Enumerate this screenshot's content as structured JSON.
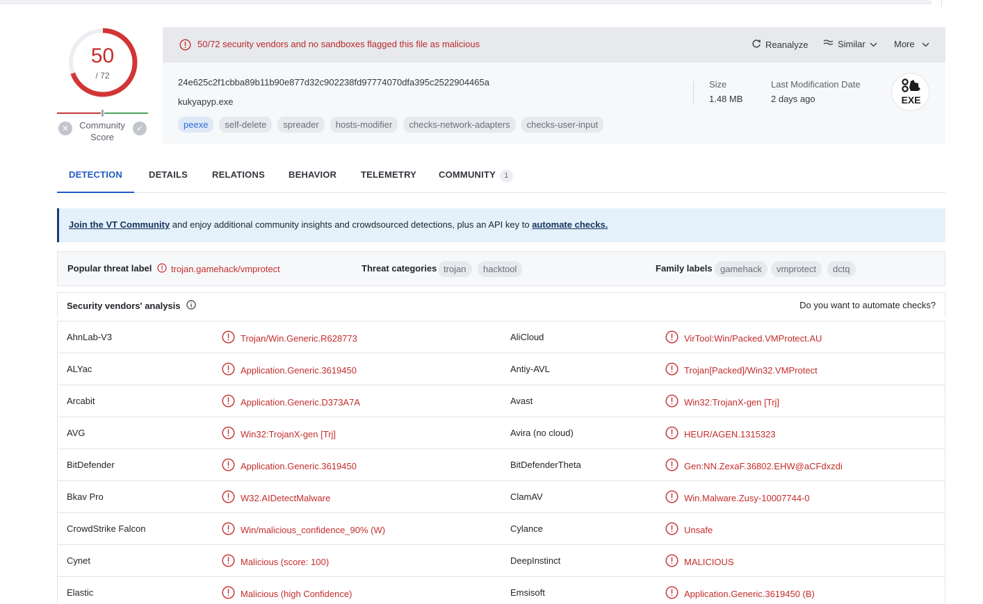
{
  "score": {
    "detections": "50",
    "total": "/ 72",
    "fraction": 0.694,
    "community_label": "Community Score"
  },
  "header": {
    "alert": "50/72 security vendors and no sandboxes flagged this file as malicious",
    "reanalyze": "Reanalyze",
    "similar": "Similar",
    "more": "More",
    "hash": "24e625c2f1cbba89b11b90e877d32c902238fd97774070dfa395c2522904465a",
    "filename": "kukyapyp.exe",
    "tags": [
      "peexe",
      "self-delete",
      "spreader",
      "hosts-modifier",
      "checks-network-adapters",
      "checks-user-input"
    ],
    "size_label": "Size",
    "size_value": "1.48 MB",
    "date_label": "Last Modification Date",
    "date_value": "2 days ago",
    "filetype": "EXE"
  },
  "tabs": [
    {
      "label": "DETECTION"
    },
    {
      "label": "DETAILS"
    },
    {
      "label": "RELATIONS"
    },
    {
      "label": "BEHAVIOR"
    },
    {
      "label": "TELEMETRY"
    },
    {
      "label": "COMMUNITY",
      "count": "1"
    }
  ],
  "banner": {
    "link1": "Join the VT Community",
    "middle": " and enjoy additional community insights and crowdsourced detections, plus an API key to ",
    "link2": "automate checks."
  },
  "labels": {
    "popular_label": "Popular threat label",
    "popular_value": "trojan.gamehack/vmprotect",
    "categories_label": "Threat categories",
    "categories": [
      "trojan",
      "hacktool"
    ],
    "family_label": "Family labels",
    "families": [
      "gamehack",
      "vmprotect",
      "dctq"
    ]
  },
  "analysis": {
    "title": "Security vendors' analysis",
    "automate": "Do you want to automate checks?",
    "rows": [
      {
        "v1": "AhnLab-V3",
        "r1": "Trojan/Win.Generic.R628773",
        "v2": "AliCloud",
        "r2": "VirTool:Win/Packed.VMProtect.AU"
      },
      {
        "v1": "ALYac",
        "r1": "Application.Generic.3619450",
        "v2": "Antiy-AVL",
        "r2": "Trojan[Packed]/Win32.VMProtect"
      },
      {
        "v1": "Arcabit",
        "r1": "Application.Generic.D373A7A",
        "v2": "Avast",
        "r2": "Win32:TrojanX-gen [Trj]"
      },
      {
        "v1": "AVG",
        "r1": "Win32:TrojanX-gen [Trj]",
        "v2": "Avira (no cloud)",
        "r2": "HEUR/AGEN.1315323"
      },
      {
        "v1": "BitDefender",
        "r1": "Application.Generic.3619450",
        "v2": "BitDefenderTheta",
        "r2": "Gen:NN.ZexaF.36802.EHW@aCFdxzdi"
      },
      {
        "v1": "Bkav Pro",
        "r1": "W32.AIDetectMalware",
        "v2": "ClamAV",
        "r2": "Win.Malware.Zusy-10007744-0"
      },
      {
        "v1": "CrowdStrike Falcon",
        "r1": "Win/malicious_confidence_90% (W)",
        "v2": "Cylance",
        "r2": "Unsafe"
      },
      {
        "v1": "Cynet",
        "r1": "Malicious (score: 100)",
        "v2": "DeepInstinct",
        "r2": "MALICIOUS"
      },
      {
        "v1": "Elastic",
        "r1": "Malicious (high Confidence)",
        "v2": "Emsisoft",
        "r2": "Application.Generic.3619450 (B)"
      }
    ]
  }
}
